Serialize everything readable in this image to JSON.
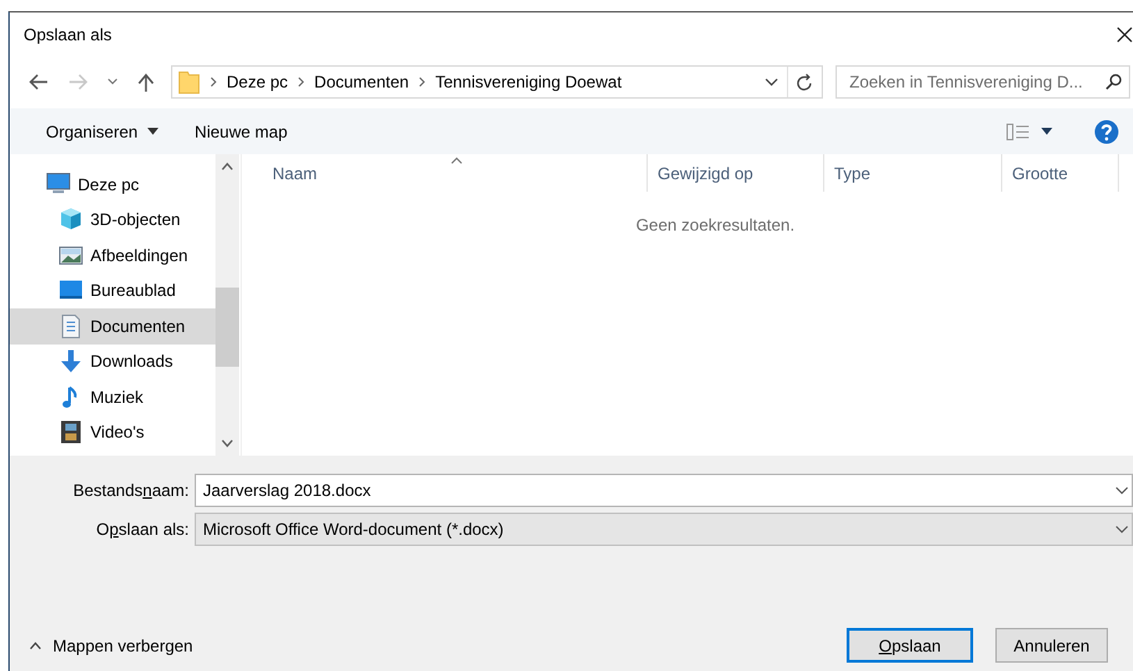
{
  "window": {
    "title": "Opslaan als"
  },
  "navigation": {
    "back_enabled": true,
    "forward_enabled": false
  },
  "address": {
    "breadcrumbs": [
      "Deze pc",
      "Documenten",
      "Tennisvereniging Doewat"
    ]
  },
  "search": {
    "placeholder": "Zoeken in Tennisvereniging D..."
  },
  "toolbar": {
    "organise": "Organiseren",
    "new_folder": "Nieuwe map"
  },
  "sidebar": {
    "items": [
      {
        "label": "Deze pc",
        "kind": "pc",
        "selected": false,
        "children": [
          {
            "label": "3D-objecten",
            "kind": "cube",
            "selected": false
          },
          {
            "label": "Afbeeldingen",
            "kind": "pictures",
            "selected": false
          },
          {
            "label": "Bureaublad",
            "kind": "desktop",
            "selected": false
          },
          {
            "label": "Documenten",
            "kind": "documents",
            "selected": true
          },
          {
            "label": "Downloads",
            "kind": "downloads",
            "selected": false
          },
          {
            "label": "Muziek",
            "kind": "music",
            "selected": false
          },
          {
            "label": "Video's",
            "kind": "videos",
            "selected": false
          }
        ]
      }
    ]
  },
  "table": {
    "columns": [
      {
        "label": "Naam",
        "sorted": true
      },
      {
        "label": "Gewijzigd op",
        "sorted": false
      },
      {
        "label": "Type",
        "sorted": false
      },
      {
        "label": "Grootte",
        "sorted": false
      }
    ],
    "empty_message": "Geen zoekresultaten."
  },
  "filename": {
    "label": [
      {
        "text": "Bestands",
        "underlined": false
      },
      {
        "text": "n",
        "underlined": true
      },
      {
        "text": "aam:",
        "underlined": false
      }
    ],
    "value": "Jaarverslag 2018.docx"
  },
  "file_type": {
    "label": [
      {
        "text": "O",
        "underlined": false
      },
      {
        "text": "p",
        "underlined": true
      },
      {
        "text": "slaan als:",
        "underlined": false
      }
    ],
    "value": "Microsoft Office Word-document (*.docx)"
  },
  "hide_folders": "Mappen verbergen",
  "buttons": [
    {
      "label": [
        {
          "text": "O",
          "underlined": true
        },
        {
          "text": "pslaan",
          "underlined": false
        }
      ],
      "default": true
    },
    {
      "label": [
        {
          "text": "Annuleren",
          "underlined": false
        }
      ],
      "default": false
    }
  ]
}
